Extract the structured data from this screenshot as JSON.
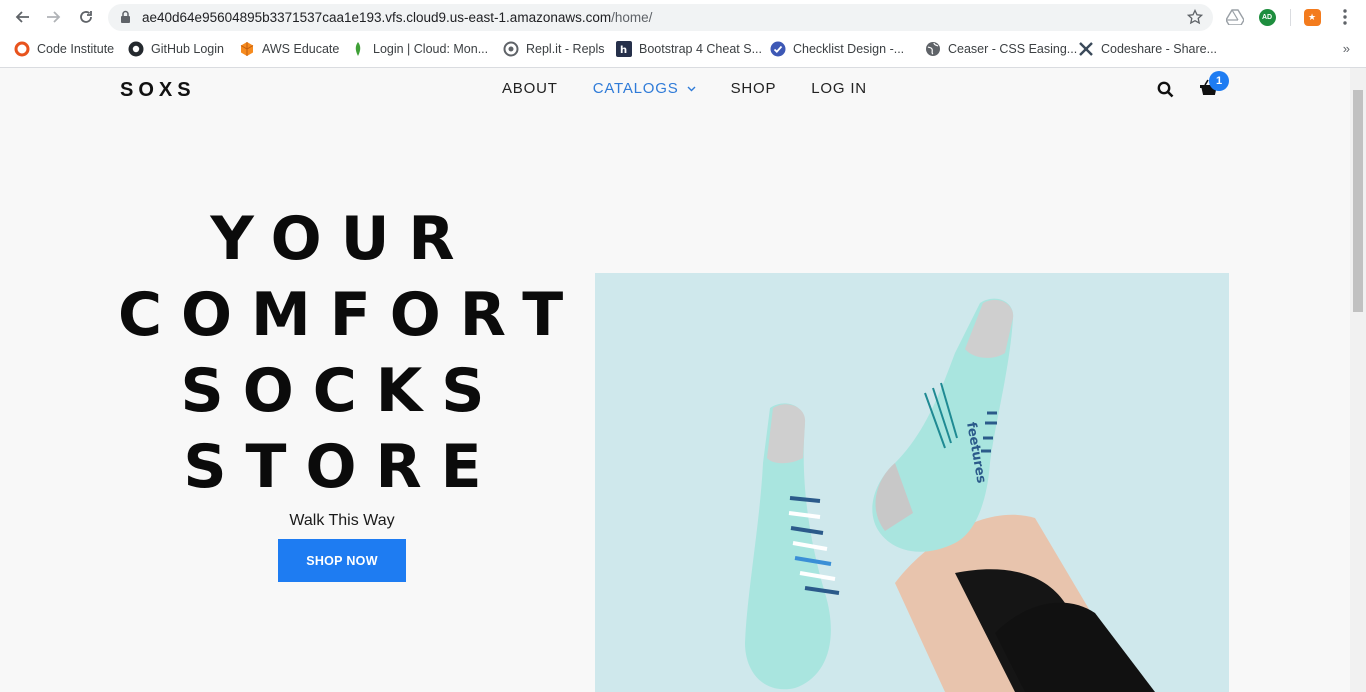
{
  "browser": {
    "url_host": "ae40d64e95604895b3371537caa1e193.vfs.cloud9.us-east-1.amazonaws.com",
    "url_path": "/home/",
    "profile_initials": "AD",
    "bookmarks": [
      {
        "label": "Code Institute"
      },
      {
        "label": "GitHub Login"
      },
      {
        "label": "AWS Educate"
      },
      {
        "label": "Login | Cloud: Mon..."
      },
      {
        "label": "Repl.it - Repls"
      },
      {
        "label": "Bootstrap 4 Cheat S..."
      },
      {
        "label": "Checklist Design -..."
      },
      {
        "label": "Ceaser - CSS Easing..."
      },
      {
        "label": "Codeshare - Share..."
      }
    ],
    "bookmarks_more": "»"
  },
  "site": {
    "brand": "SOXS",
    "nav": [
      {
        "label": "ABOUT"
      },
      {
        "label": "CATALOGS",
        "active": true
      },
      {
        "label": "SHOP"
      },
      {
        "label": "LOG IN"
      }
    ],
    "cart_count": "1"
  },
  "hero": {
    "title_lines": [
      "YOUR",
      "COMFORT",
      "SOCKS",
      "STORE"
    ],
    "tagline": "Walk This Way",
    "cta": "SHOP NOW",
    "image_bg": "#cfe8ec",
    "sock_color": "#a9e5df",
    "sock_brand_text": "feetures"
  },
  "colors": {
    "accent": "#1e7cf2",
    "nav_active": "#2f7bd8"
  }
}
